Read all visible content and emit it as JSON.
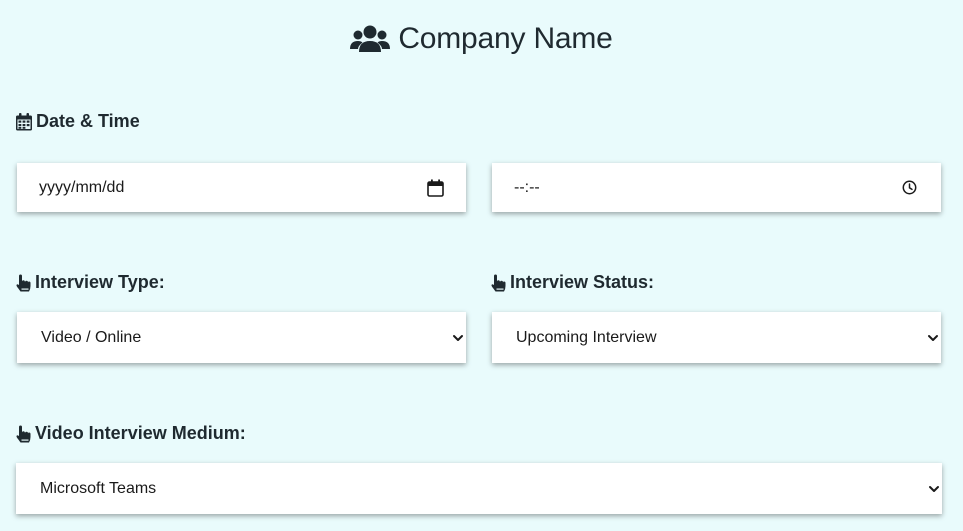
{
  "header": {
    "icon": "users-icon",
    "title": "Company Name"
  },
  "date_time": {
    "icon": "calendar-icon",
    "label": "Date & Time",
    "date_field": {
      "placeholder": "yyyy/mm/dd",
      "icon": "calendar-picker-icon"
    },
    "time_field": {
      "placeholder": "--:--",
      "icon": "clock-icon"
    }
  },
  "interview_type": {
    "icon": "pointer-hand-icon",
    "label": "Interview Type:",
    "selected": "Video / Online"
  },
  "interview_status": {
    "icon": "pointer-hand-icon",
    "label": "Interview Status:",
    "selected": "Upcoming Interview"
  },
  "video_medium": {
    "icon": "pointer-hand-icon",
    "label": "Video Interview Medium:",
    "selected": "Microsoft Teams"
  },
  "colors": {
    "background": "#e9fbfc",
    "text": "#1f2a30",
    "field": "#ffffff"
  }
}
